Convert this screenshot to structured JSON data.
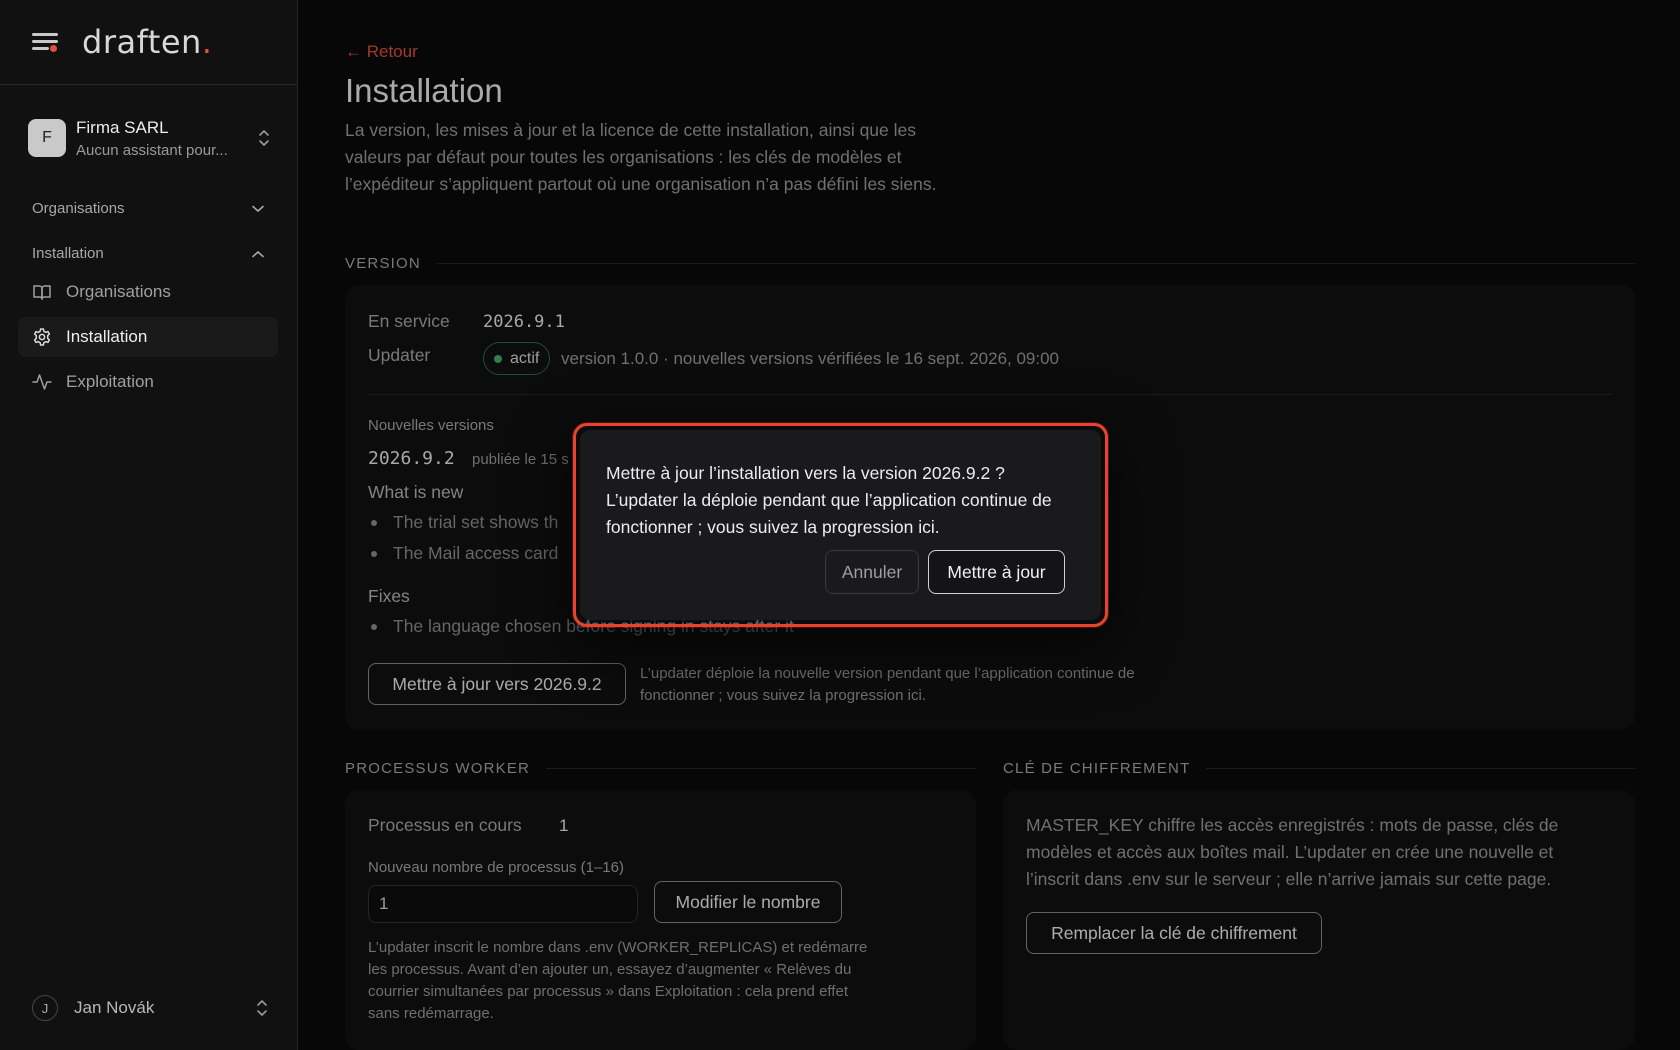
{
  "brand": {
    "logo_text": "draften",
    "logo_dot": ".",
    "accent": "#e0503a"
  },
  "org": {
    "avatar": "F",
    "name": "Firma SARL",
    "subtitle": "Aucun assistant pour..."
  },
  "sidebar": {
    "groups": [
      {
        "label": "Organisations",
        "expanded": false
      },
      {
        "label": "Installation",
        "expanded": true
      }
    ],
    "items": [
      {
        "label": "Organisations",
        "icon": "book-icon",
        "active": false
      },
      {
        "label": "Installation",
        "icon": "gear-icon",
        "active": true
      },
      {
        "label": "Exploitation",
        "icon": "activity-icon",
        "active": false
      }
    ]
  },
  "user": {
    "avatar": "J",
    "name": "Jan Novák"
  },
  "page": {
    "back": "← Retour",
    "title": "Installation",
    "description": "La version, les mises à jour et la licence de cette installation, ainsi que les valeurs par défaut pour toutes les organisations : les clés de modèles et l’expéditeur s’appliquent partout où une organisation n’a pas défini les siens."
  },
  "version": {
    "section": "VERSION",
    "in_service_label": "En service",
    "in_service_value": "2026.9.1",
    "updater_label": "Updater",
    "updater_status": "actif",
    "updater_status_color": "#3fb068",
    "updater_info": "version 1.0.0 · nouvelles versions vérifiées le 16 sept. 2026, 09:00",
    "new_versions_label": "Nouvelles versions",
    "new_version": "2026.9.2",
    "published": "publiée le 15 s",
    "whats_new_title": "What is new",
    "whats_new": [
      "The trial set shows th",
      "The Mail access card"
    ],
    "fixes_title": "Fixes",
    "fixes": [
      "The language chosen before signing in stays after it"
    ],
    "update_button": "Mettre à jour vers 2026.9.2",
    "update_note": "L’updater déploie la nouvelle version pendant que l’application continue de fonctionner ; vous suivez la progression ici."
  },
  "workers": {
    "section": "PROCESSUS WORKER",
    "running_label": "Processus en cours",
    "running_value": "1",
    "new_count_label": "Nouveau nombre de processus (1–16)",
    "new_count_value": "1",
    "modify_button": "Modifier le nombre",
    "note": "L’updater inscrit le nombre dans .env (WORKER_REPLICAS) et redémarre les processus. Avant d’en ajouter un, essayez d’augmenter « Relèves du courrier simultanées par processus » dans Exploitation : cela prend effet sans redémarrage."
  },
  "encryption": {
    "section": "CLÉ DE CHIFFREMENT",
    "text": "MASTER_KEY chiffre les accès enregistrés : mots de passe, clés de modèles et accès aux boîtes mail. L’updater en crée une nouvelle et l’inscrit dans .env sur le serveur ; elle n’arrive jamais sur cette page.",
    "replace_button": "Remplacer la clé de chiffrement"
  },
  "modal": {
    "text": "Mettre à jour l’installation vers la version 2026.9.2 ? L’updater la déploie pendant que l’application continue de fonctionner ; vous suivez la progression ici.",
    "cancel": "Annuler",
    "confirm": "Mettre à jour",
    "ring_color": "#e8432f"
  }
}
